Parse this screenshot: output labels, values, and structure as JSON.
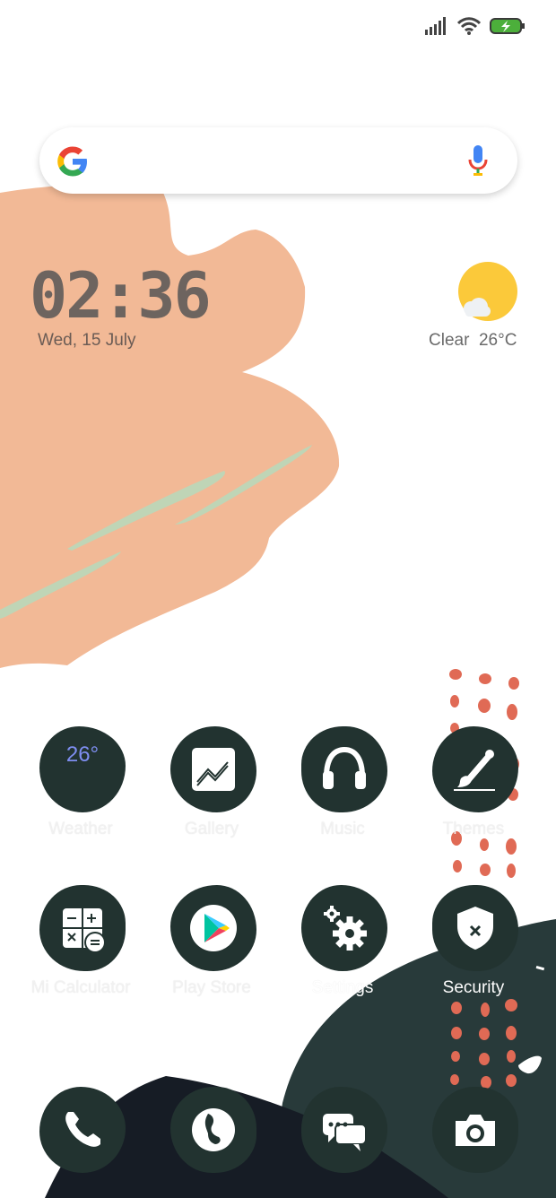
{
  "status_bar": {
    "signal_icon": "signal-bars-icon",
    "wifi_icon": "wifi-icon",
    "battery_icon": "battery-charging-icon"
  },
  "search": {
    "logo": "google-g-icon",
    "mic": "mic-icon"
  },
  "clock": {
    "time": "02:36",
    "date": "Wed, 15 July"
  },
  "weather": {
    "condition": "Clear",
    "temp": "26°C",
    "icon": "sun-cloud-icon"
  },
  "apps_row1": [
    {
      "label": "Weather",
      "temp": "26°"
    },
    {
      "label": "Gallery"
    },
    {
      "label": "Music"
    },
    {
      "label": "Themes"
    }
  ],
  "apps_row2": [
    {
      "label": "Mi Calculator"
    },
    {
      "label": "Play Store"
    },
    {
      "label": "Settings"
    },
    {
      "label": "Security"
    }
  ],
  "dock": [
    {
      "icon": "phone-icon"
    },
    {
      "icon": "browser-icon"
    },
    {
      "icon": "messages-icon"
    },
    {
      "icon": "camera-icon"
    }
  ],
  "colors": {
    "blob": "#223330",
    "peach": "#f2b996",
    "dots": "#e06a55",
    "dark": "#1c2b2b"
  }
}
